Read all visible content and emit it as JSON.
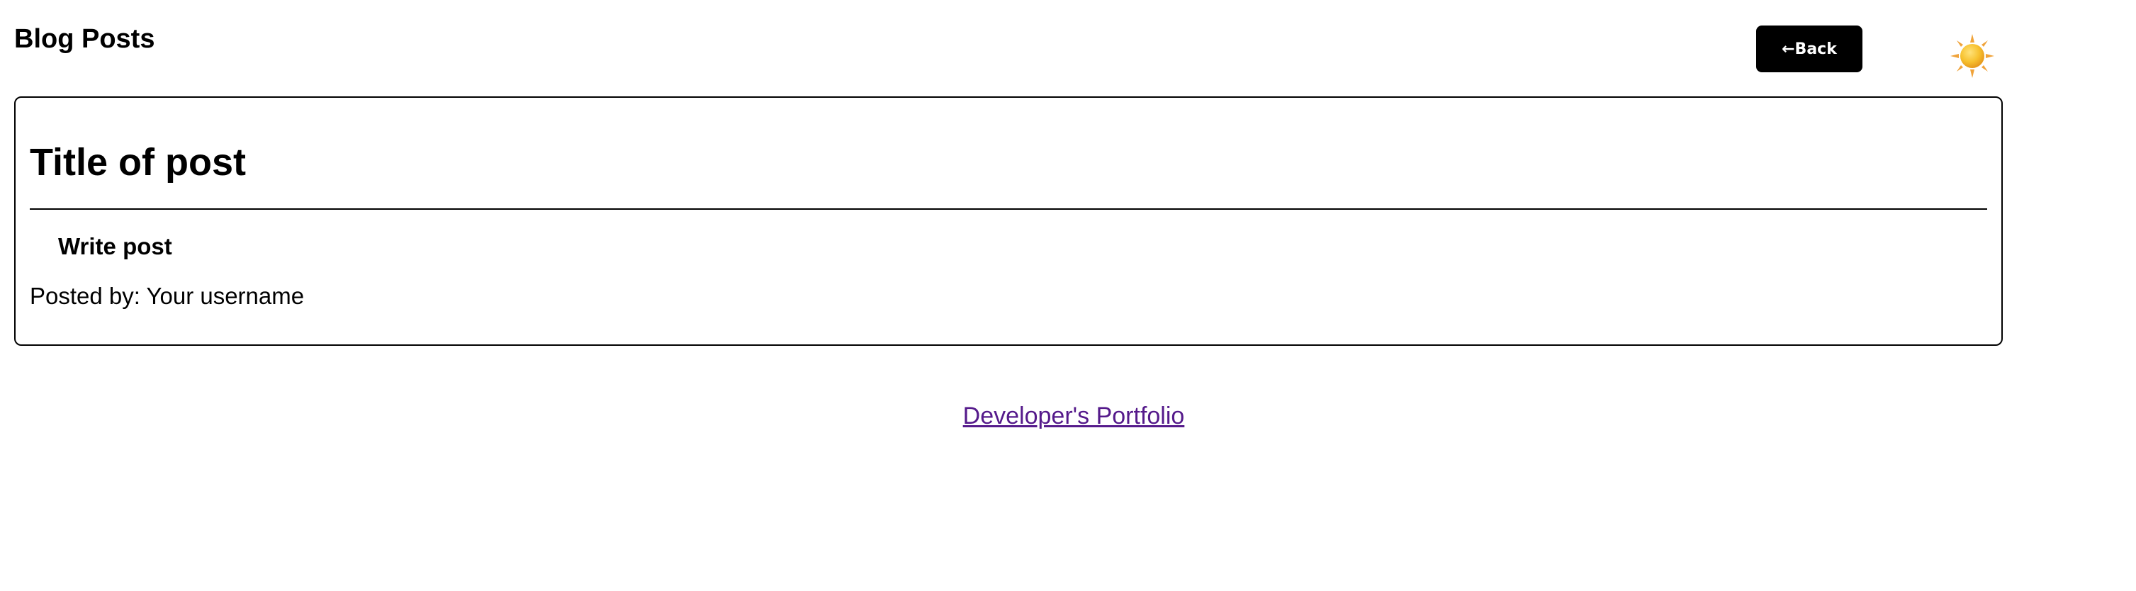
{
  "header": {
    "title": "Blog Posts",
    "back_label": "←Back",
    "theme_icon": "sun-icon"
  },
  "post": {
    "title": "Title of post",
    "action_label": "Write post",
    "posted_by": "Posted by: Your username"
  },
  "footer": {
    "link_text": "Developer's Portfolio"
  },
  "colors": {
    "button_bg": "#000000",
    "button_text": "#ffffff",
    "link_visited": "#551a8b",
    "sun_core": "#f5b624",
    "sun_rays": "#f0a33a"
  }
}
